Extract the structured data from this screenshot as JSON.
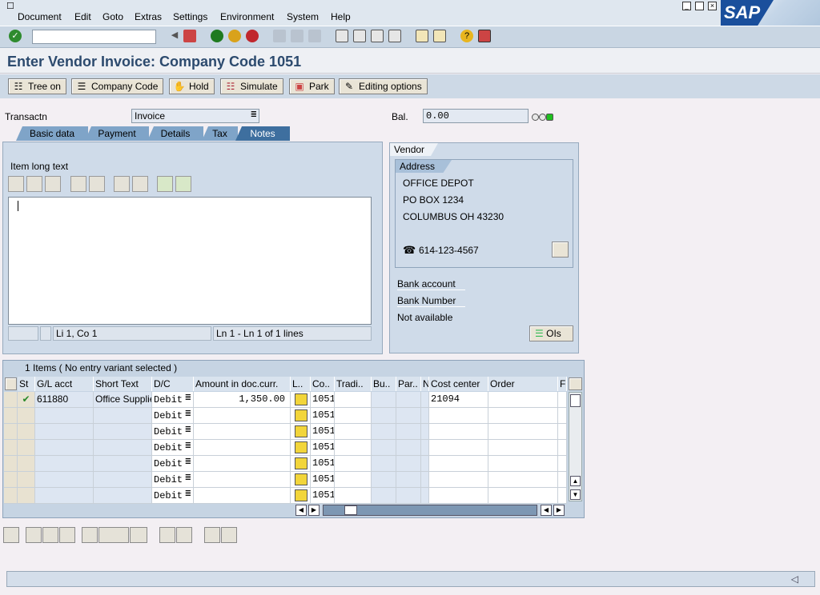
{
  "menu": [
    "Document",
    "Edit",
    "Goto",
    "Extras",
    "Settings",
    "Environment",
    "System",
    "Help"
  ],
  "sap_logo": "SAP",
  "title": "Enter Vendor Invoice: Company Code 1051",
  "app_toolbar": [
    "Tree on",
    "Company Code",
    "Hold",
    "Simulate",
    "Park",
    "Editing options"
  ],
  "transaction": {
    "label": "Transactn",
    "value": "Invoice"
  },
  "balance": {
    "label": "Bal.",
    "value": "0.00"
  },
  "tabs": [
    "Basic data",
    "Payment",
    "Details",
    "Tax",
    "Notes"
  ],
  "notes": {
    "label": "Item long text",
    "status_pos": "Li 1, Co 1",
    "status_lines": "Ln 1 - Ln 1 of 1 lines"
  },
  "vendor": {
    "header": "Vendor",
    "address_tab": "Address",
    "name": "OFFICE DEPOT",
    "street": "PO BOX 1234",
    "city": "COLUMBUS OH  43230",
    "phone": "614-123-4567",
    "bank_account": "Bank account",
    "bank_number": "Bank Number",
    "not_available": "Not available",
    "ois_button": "OIs"
  },
  "items": {
    "title": "1 Items ( No entry variant selected )",
    "columns": [
      "St",
      "G/L acct",
      "Short Text",
      "D/C",
      "Amount in doc.curr.",
      "L..",
      "Co..",
      "Tradi..",
      "Bu..",
      "Par..",
      "N",
      "Cost center",
      "Order",
      "Fi"
    ],
    "rows": [
      {
        "gl": "611880",
        "text": "Office Supplie",
        "dc": "Debit",
        "amount": "1,350.00",
        "co": "1051",
        "cc": "21094"
      },
      {
        "gl": "",
        "text": "",
        "dc": "Debit",
        "amount": "",
        "co": "1051",
        "cc": ""
      },
      {
        "gl": "",
        "text": "",
        "dc": "Debit",
        "amount": "",
        "co": "1051",
        "cc": ""
      },
      {
        "gl": "",
        "text": "",
        "dc": "Debit",
        "amount": "",
        "co": "1051",
        "cc": ""
      },
      {
        "gl": "",
        "text": "",
        "dc": "Debit",
        "amount": "",
        "co": "1051",
        "cc": ""
      },
      {
        "gl": "",
        "text": "",
        "dc": "Debit",
        "amount": "",
        "co": "1051",
        "cc": ""
      },
      {
        "gl": "",
        "text": "",
        "dc": "Debit",
        "amount": "",
        "co": "1051",
        "cc": ""
      }
    ]
  }
}
